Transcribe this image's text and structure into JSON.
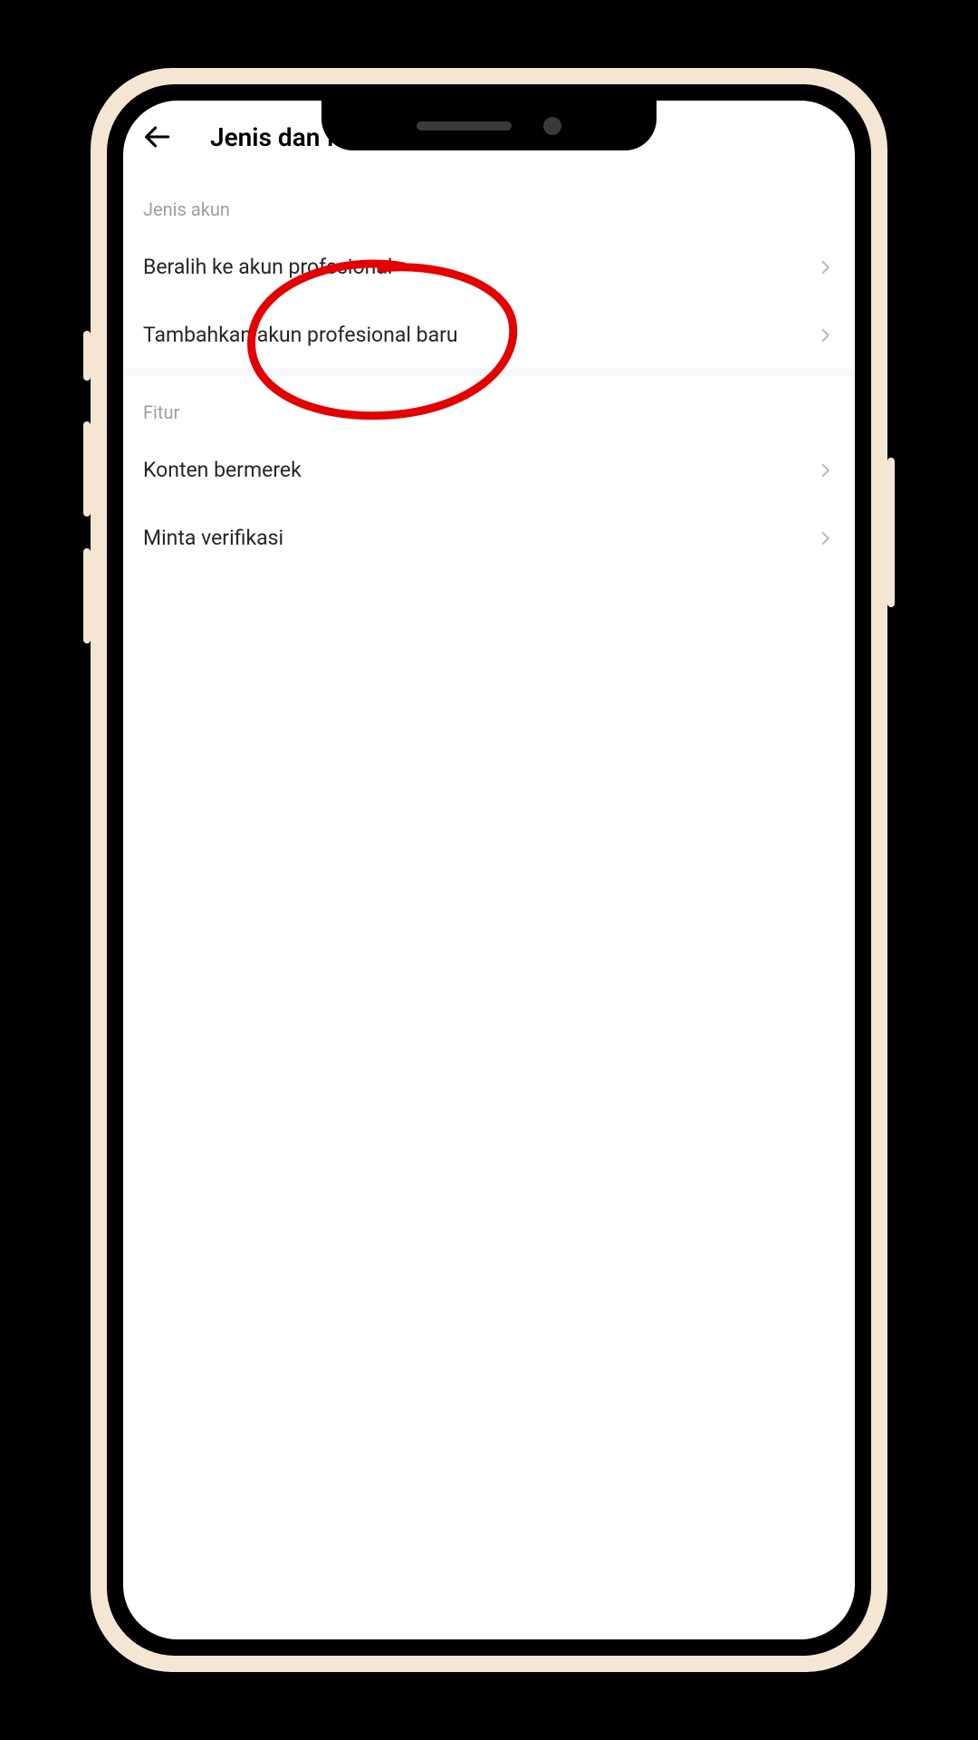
{
  "header": {
    "title": "Jenis dan fitur akun"
  },
  "sections": {
    "account_type": {
      "header": "Jenis akun",
      "items": [
        {
          "label": "Beralih ke akun profesional"
        },
        {
          "label": "Tambahkan akun profesional baru"
        }
      ]
    },
    "features": {
      "header": "Fitur",
      "items": [
        {
          "label": "Konten bermerek"
        },
        {
          "label": "Minta verifikasi"
        }
      ]
    }
  },
  "annotation": {
    "circle_color": "#e40000"
  }
}
